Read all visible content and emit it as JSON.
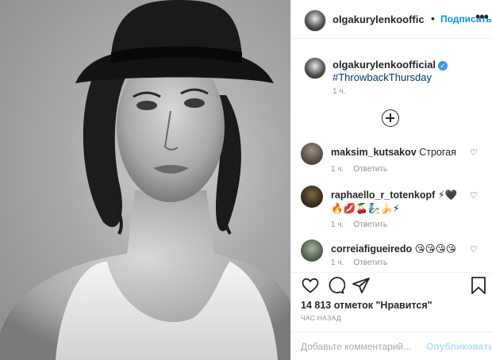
{
  "post": {
    "author": "olgakurylenkooffic",
    "follow_label": "Подписаться",
    "more_label": "•••",
    "dot": "•"
  },
  "caption": {
    "username": "olgakurylenkoofficial",
    "verified_mark": "✓",
    "hashtag": "#ThrowbackThursday",
    "time": "1 ч."
  },
  "comments": [
    {
      "username": "maksim_kutsakov",
      "text": "Строгая",
      "time": "1 ч.",
      "reply": "Ответить"
    },
    {
      "username": "raphaello_r_totenkopf",
      "text": "⚡🖤🔥💋🍒🧞🍌⚡",
      "time": "1 ч.",
      "reply": "Ответить"
    },
    {
      "username": "correiafigueiredo",
      "text": "😘😘😘😘",
      "time": "1 ч.",
      "reply": "Ответить"
    }
  ],
  "likes": "14 813 отметок \"Нравится\"",
  "post_time": "час назад",
  "composer": {
    "placeholder": "Добавьте комментарий...",
    "publish_label": "Опубликовать"
  },
  "heart_glyph": "♡",
  "colors": {
    "accent": "#0095f6",
    "publish_disabled": "#b2dffc",
    "verified": "#3897f0"
  }
}
